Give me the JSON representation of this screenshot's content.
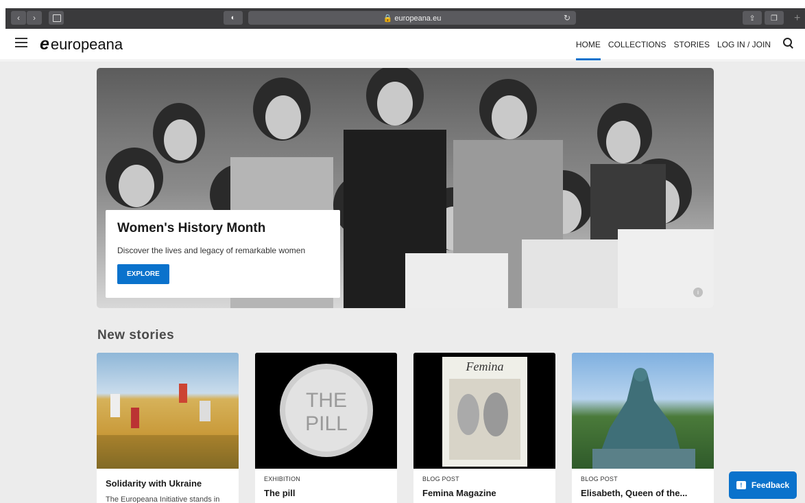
{
  "browser": {
    "url": "🔒 europeana.eu"
  },
  "header": {
    "logo_mark": "e",
    "logo_text": "europeana",
    "nav": [
      "HOME",
      "COLLECTIONS",
      "STORIES",
      "LOG IN / JOIN"
    ]
  },
  "hero": {
    "title": "Women's History Month",
    "subtitle": "Discover the lives and legacy of remarkable women",
    "cta": "EXPLORE",
    "info": "i"
  },
  "stories": {
    "section_title": "New stories",
    "cards": [
      {
        "kicker": "",
        "title": "Solidarity with Ukraine",
        "desc": "The Europeana Initiative stands in"
      },
      {
        "kicker": "EXHIBITION",
        "title": "The pill",
        "desc": ""
      },
      {
        "kicker": "BLOG POST",
        "title": "Femina Magazine",
        "desc": ""
      },
      {
        "kicker": "BLOG POST",
        "title": "Elisabeth, Queen of the...",
        "desc": ""
      }
    ],
    "pill_text_line1": "THE",
    "pill_text_line2": "PILL",
    "femina_masthead": "Femina"
  },
  "feedback": {
    "label": "Feedback"
  },
  "colors": {
    "accent": "#0a72cc",
    "chrome": "#3a3a3c",
    "page_bg": "#ececec"
  }
}
